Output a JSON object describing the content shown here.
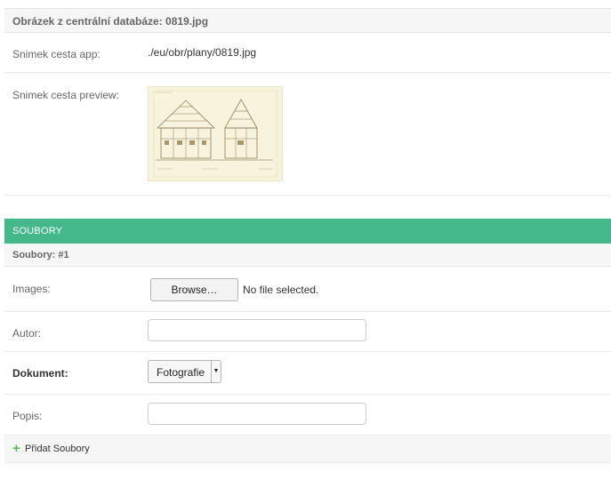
{
  "db_section": {
    "title": "Obrázek z centrální databáze: 0819.jpg",
    "app_path_label": "Snimek cesta app:",
    "app_path_value": "./eu/obr/plany/0819.jpg",
    "preview_label": "Snimek cesta preview:",
    "preview_icon": "architectural-drawing-thumbnail"
  },
  "module": {
    "title": "SOUBORY"
  },
  "inline": {
    "title": "Soubory: #1",
    "images_label": "Images:",
    "browse_label": "Browse…",
    "no_file_text": "No file selected.",
    "autor_label": "Autor:",
    "autor_value": "",
    "dokument_label": "Dokument:",
    "dokument_value": "Fotografie",
    "popis_label": "Popis:",
    "popis_value": ""
  },
  "add_link": {
    "label": "Přidat Soubory",
    "icon": "plus-icon"
  },
  "colors": {
    "module_header": "#44b78b",
    "add_icon": "#5cb85c"
  }
}
